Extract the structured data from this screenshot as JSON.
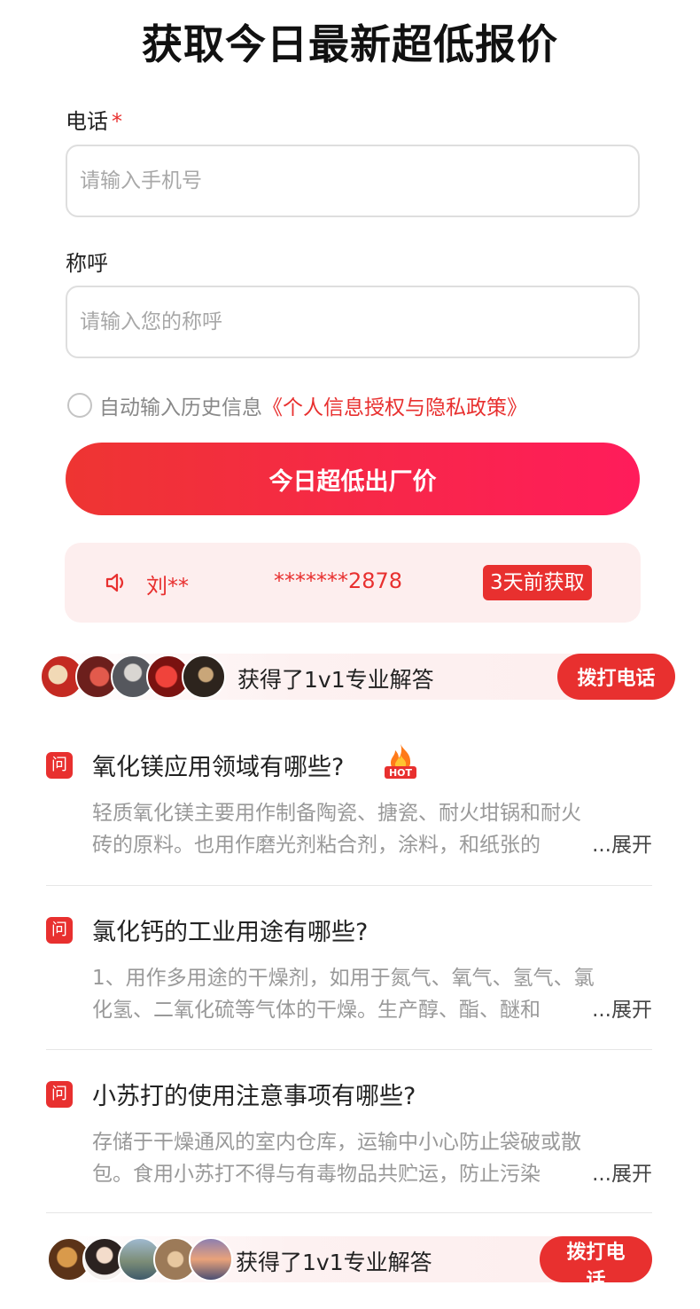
{
  "header": {
    "title": "获取今日最新超低报价"
  },
  "form": {
    "phone_label": "电话",
    "phone_required_mark": "*",
    "phone_placeholder": "请输入手机号",
    "name_label": "称呼",
    "name_placeholder": "请输入您的称呼",
    "agree_text": "自动输入历史信息",
    "agree_link": "《个人信息授权与隐私政策》",
    "submit_label": "今日超低出厂价"
  },
  "ticker": {
    "name": "刘**",
    "phone": "*******2878",
    "badge": "3天前获取"
  },
  "expert_strip": {
    "text": "获得了1v1专业解答",
    "call_label": "拨打电话"
  },
  "questions": [
    {
      "icon_label": "问",
      "title": "氧化镁应用领域有哪些?",
      "hot": true,
      "answer_line1": "轻质氧化镁主要用作制备陶瓷、搪瓷、耐火坩锅和耐火",
      "answer_line2": "砖的原料。也用作磨光剂粘合剂，涂料，和纸张的",
      "more_label": "...展开"
    },
    {
      "icon_label": "问",
      "title": "氯化钙的工业用途有哪些?",
      "hot": false,
      "answer_line1": "1、用作多用途的干燥剂，如用于氮气、氧气、氢气、氯",
      "answer_line2": "化氢、二氧化硫等气体的干燥。生产醇、酯、醚和",
      "more_label": "...展开"
    },
    {
      "icon_label": "问",
      "title": "小苏打的使用注意事项有哪些?",
      "hot": false,
      "answer_line1": "存储于干燥通风的室内仓库，运输中小心防止袋破或散",
      "answer_line2": "包。食用小苏打不得与有毒物品共贮运，防止污染",
      "more_label": "...展开"
    }
  ],
  "colors": {
    "accent": "#e8302f",
    "gradient_end": "#ff1c5b",
    "ticker_bg": "#fdeeee"
  },
  "icons": {
    "speaker": "speaker-icon",
    "hot": "hot-fire-icon",
    "question": "question-badge-icon"
  }
}
